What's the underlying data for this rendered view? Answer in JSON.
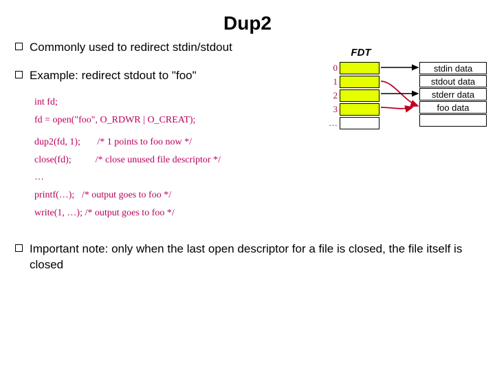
{
  "title": "Dup2",
  "bullets": {
    "b1": "Commonly used to redirect stdin/stdout",
    "b2": "Example: redirect stdout to \"foo\"",
    "b3": "Important note: only when the last open descriptor for a file is closed, the file itself is closed"
  },
  "code": {
    "l1": "int fd;",
    "l2": "fd = open(\"foo\", O_RDWR | O_CREAT);",
    "l3": "dup2(fd, 1);       /* 1 points to foo now */",
    "l4": "close(fd);          /* close unused file descriptor */",
    "l5": "…",
    "l6": "printf(…);   /* output goes to foo */",
    "l7": "write(1, …); /* output goes to foo */"
  },
  "fdt": {
    "label": "FDT",
    "rows": [
      "0",
      "1",
      "2",
      "3",
      "…"
    ]
  },
  "data_cells": {
    "d0": "stdin data",
    "d1": "stdout data",
    "d2": "stderr data",
    "d3": "foo data"
  }
}
